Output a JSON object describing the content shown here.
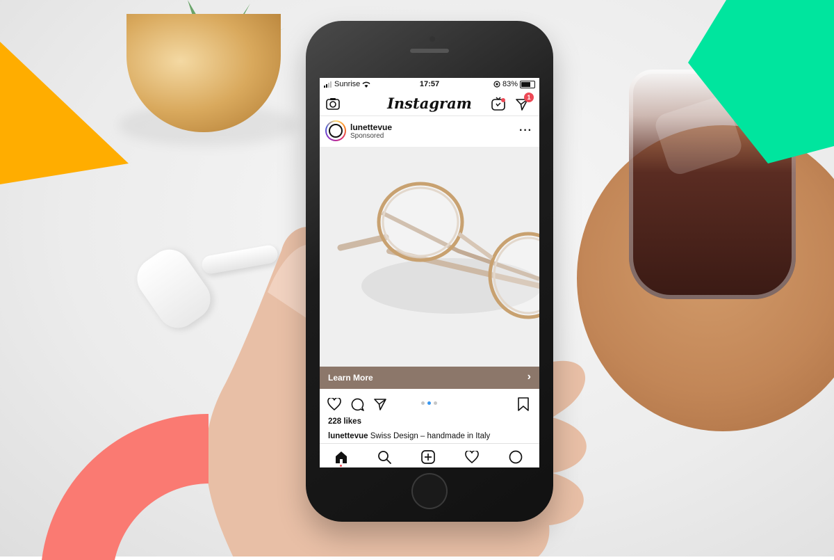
{
  "status_bar": {
    "carrier": "Sunrise",
    "time": "17:57",
    "battery": "83%",
    "battery_level": 0.83
  },
  "app": {
    "logo": "Instagram",
    "dm_badge": "1"
  },
  "post": {
    "username": "lunettevue",
    "label": "Sponsored",
    "more": "···",
    "cta_label": "Learn More",
    "likes": "228 likes",
    "caption_user": "lunettevue",
    "caption_text": "Swiss Design – handmade in Italy",
    "carousel": {
      "count": 3,
      "active": 2
    }
  },
  "icons": {
    "top": [
      "camera-icon",
      "igtv-icon",
      "direct-message-icon"
    ],
    "actions": [
      "heart-icon",
      "comment-icon",
      "share-icon",
      "bookmark-icon"
    ],
    "bottom_nav": [
      "home-icon",
      "search-icon",
      "new-post-icon",
      "activity-icon",
      "profile-icon"
    ]
  },
  "colors": {
    "cta_bar": "#8c776a",
    "badge": "#ed4956",
    "carousel_active": "#3897f0",
    "deco_orange": "#ffad00",
    "deco_green": "#00e59e",
    "deco_pink": "#fa7a72"
  }
}
